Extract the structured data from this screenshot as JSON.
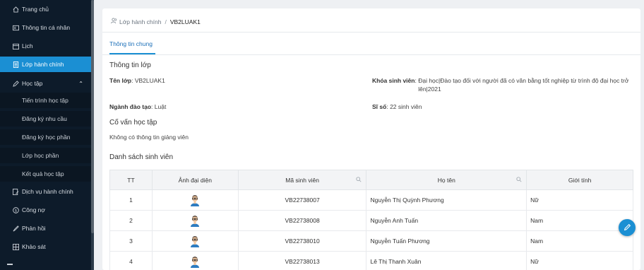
{
  "sidebar": {
    "items": [
      {
        "label": "Trang chủ",
        "icon": "home-icon"
      },
      {
        "label": "Thông tin cá nhân",
        "icon": "id-card-icon"
      },
      {
        "label": "Lịch",
        "icon": "calendar-icon"
      },
      {
        "label": "Lớp hành chính",
        "icon": "document-icon"
      },
      {
        "label": "Học tập",
        "icon": "pen-icon"
      },
      {
        "label": "Dịch vụ hành chính",
        "icon": "edit-doc-icon"
      },
      {
        "label": "Công nợ",
        "icon": "dollar-circle-icon"
      },
      {
        "label": "Phản hồi",
        "icon": "feedback-icon"
      },
      {
        "label": "Khảo sát",
        "icon": "grid-icon"
      }
    ],
    "subitems": [
      {
        "label": "Tiến trình học tập"
      },
      {
        "label": "Đăng ký nhu cầu"
      },
      {
        "label": "Đăng ký học phần"
      },
      {
        "label": "Lớp học phần"
      },
      {
        "label": "Kết quả học tập"
      }
    ]
  },
  "breadcrumb": {
    "parent": "Lớp hành chính",
    "separator": "/",
    "current": "VB2LUAK1"
  },
  "tabs": {
    "active": "Thông tin chung"
  },
  "class_info": {
    "title": "Thông tin lớp",
    "name_label": "Tên lớp",
    "name_value": "VB2LUAK1",
    "course_label": "Khóa sinh viên",
    "course_value_line1": "Đại học|Đào tạo đối với người đã có văn bằng tốt nghiệp từ trình độ đại học trở",
    "course_value_line2": "lên|2021",
    "major_label": "Ngành đào tạo",
    "major_value": "Luật",
    "size_label": "Sĩ số",
    "size_value": "22 sinh viên",
    "colon": ":"
  },
  "advisor": {
    "title": "Cố vấn học tập",
    "value": "Không có thông tin giảng viên"
  },
  "students": {
    "title": "Danh sách sinh viên",
    "columns": {
      "no": "TT",
      "avatar": "Ảnh đại diện",
      "id": "Mã sinh viên",
      "name": "Họ tên",
      "gender": "Giới tính"
    },
    "rows": [
      {
        "no": "1",
        "id": "VB22738007",
        "name": "Nguyễn Thị Quỳnh Phương",
        "gender": "Nữ"
      },
      {
        "no": "2",
        "id": "VB22738008",
        "name": "Nguyễn Anh Tuấn",
        "gender": "Nam"
      },
      {
        "no": "3",
        "id": "VB22738010",
        "name": "Nguyễn Tuấn Phương",
        "gender": "Nam"
      },
      {
        "no": "4",
        "id": "VB22738013",
        "name": "Lê Thị Thanh Xuân",
        "gender": "Nữ"
      }
    ]
  },
  "colors": {
    "accent": "#1b8fd3",
    "sidebar_bg": "#0d1b2a"
  }
}
